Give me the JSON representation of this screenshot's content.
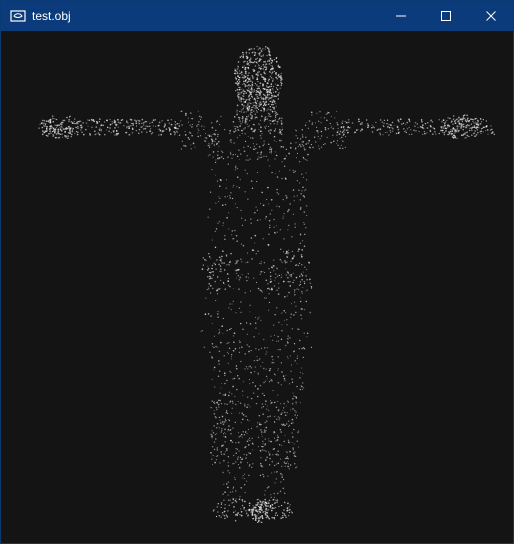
{
  "window": {
    "title": "test.obj",
    "controls": {
      "minimize_icon": "minimize-icon",
      "maximize_icon": "maximize-icon",
      "close_icon": "close-icon"
    }
  },
  "colors": {
    "titlebar": "#0b3b7a",
    "viewport_background": "#141414",
    "point_cloud": "#e6e6e6"
  },
  "viewport": {
    "object": "point-cloud-human-model"
  }
}
